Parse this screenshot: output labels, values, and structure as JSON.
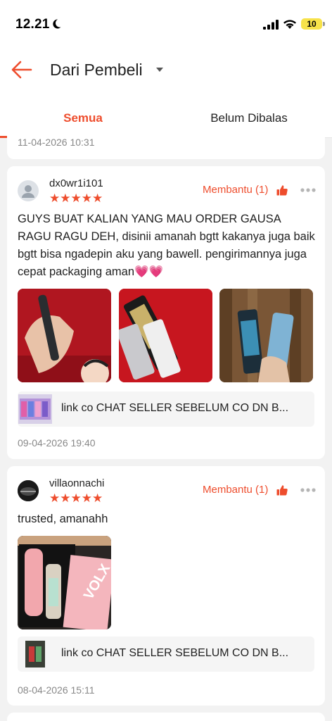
{
  "status_bar": {
    "time": "12.21",
    "battery": "10"
  },
  "header": {
    "title": "Dari Pembeli"
  },
  "tabs": [
    {
      "label": "Semua",
      "active": true
    },
    {
      "label": "Belum Dibalas",
      "active": false
    }
  ],
  "previous_review": {
    "date": "11-04-2026 10:31"
  },
  "reviews": [
    {
      "username": "dx0wr1i101",
      "stars": "★★★★★",
      "rating": 5,
      "helpful_label": "Membantu (1)",
      "text": "GUYS BUAT KALIAN YANG MAU ORDER GAUSA RAGU RAGU DEH, disinii amanah bgtt kakanya juga baik bgtt bisa ngadepin aku yang bawell. pengirimannya juga cepat packaging aman💗💗",
      "product_link": "link co CHAT SELLER SEBELUM CO DN B...",
      "date": "09-04-2026 19:40"
    },
    {
      "username": "villaonnachi",
      "stars": "★★★★★",
      "rating": 5,
      "helpful_label": "Membantu (1)",
      "text": "trusted, amanahh",
      "product_link": "link co CHAT SELLER SEBELUM CO DN B...",
      "date": "08-04-2026 15:11"
    }
  ],
  "colors": {
    "accent": "#ee4d2d",
    "background": "#f2f2f2"
  }
}
